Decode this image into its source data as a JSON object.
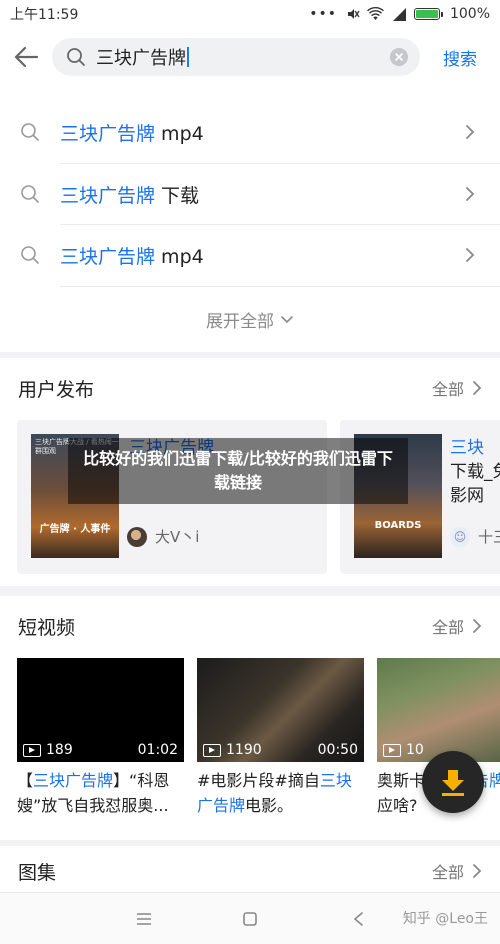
{
  "status_bar": {
    "time": "上午11:59",
    "battery": "100%",
    "icons": [
      "more-icon",
      "mute-icon",
      "wifi-icon",
      "signal-icon",
      "battery-icon"
    ]
  },
  "search": {
    "query": "三块广告牌",
    "submit_label": "搜索"
  },
  "suggestions": {
    "items": [
      {
        "highlight": "三块广告牌",
        "rest": " mp4"
      },
      {
        "highlight": "三块广告牌",
        "rest": " 下载"
      },
      {
        "highlight": "三块广告牌",
        "rest": " mp4"
      }
    ],
    "expand_label": "展开全部"
  },
  "user_posts": {
    "title": "用户发布",
    "more_label": "全部",
    "cards": [
      {
        "poster_top": "三块广告牌大战 / 看热闹一群围观",
        "poster_mid": "广告牌 · 人事件",
        "title_hl": "三块广告牌",
        "author": "大V丶i"
      },
      {
        "poster_top": "",
        "poster_mid": "BOARDS",
        "title_hl": "三块",
        "title_line2": "下载_免",
        "title_line3": "影网",
        "author": "十三"
      }
    ]
  },
  "overlay": {
    "text": "比较好的我们迅雷下载/比较好的我们迅雷下载链接"
  },
  "short_videos": {
    "title": "短视频",
    "more_label": "全部",
    "items": [
      {
        "plays": "189",
        "duration": "01:02",
        "caption_pre": "【",
        "caption_hl": "三块广告牌",
        "caption_post": "】“科恩嫂”放飞自我怼服奥..."
      },
      {
        "plays": "1190",
        "duration": "00:50",
        "caption_pre": "#电影片段#摘自",
        "caption_hl": "三块广告牌",
        "caption_post": "电影。"
      },
      {
        "plays": "10",
        "duration": "",
        "caption_pre": "奥斯卡",
        "caption_hl": "三块广告牌",
        "caption_post": "》回应啥?"
      }
    ]
  },
  "albums": {
    "title": "图集",
    "more_label": "全部"
  },
  "watermark": "知乎 @Leo王",
  "colors": {
    "accent": "#1a73e8",
    "caret": "#1f7ce0",
    "battery": "#3dbf4e"
  }
}
